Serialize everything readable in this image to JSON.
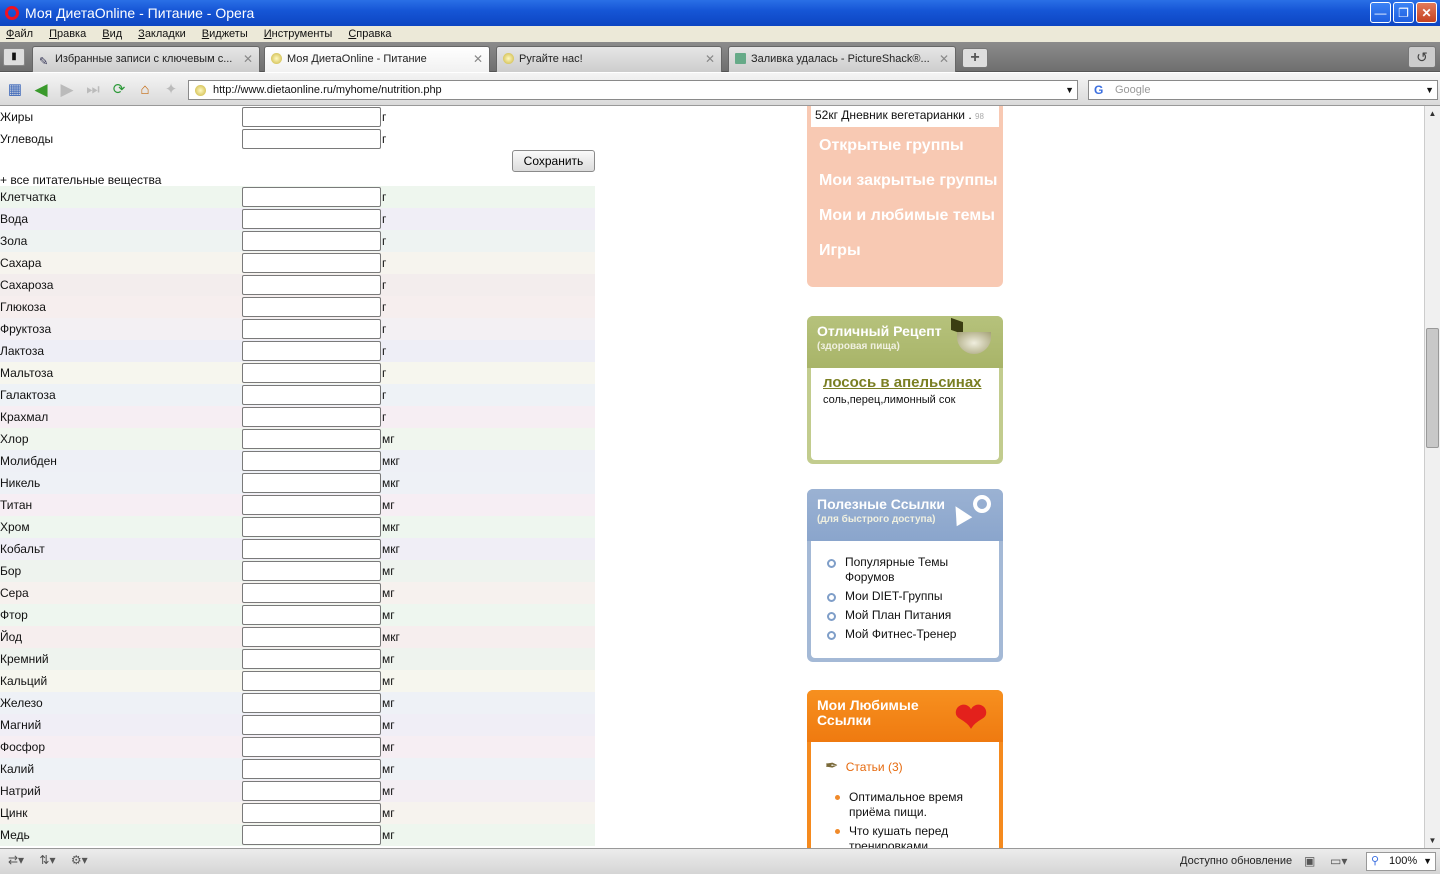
{
  "window": {
    "title": "Моя ДиетаOnline - Питание - Opera"
  },
  "menu": [
    "Файл",
    "Правка",
    "Вид",
    "Закладки",
    "Виджеты",
    "Инструменты",
    "Справка"
  ],
  "tabs": [
    {
      "label": "Избранные записи с ключевым с...",
      "active": false
    },
    {
      "label": "Моя ДиетаOnline - Питание",
      "active": true
    },
    {
      "label": "Ругайте нас!",
      "active": false
    },
    {
      "label": "Заливка удалась - PictureShack®...",
      "active": false
    }
  ],
  "address": {
    "url": "http://www.dietaonline.ru/myhome/nutrition.php",
    "search_placeholder": "Google"
  },
  "form": {
    "top_rows": [
      {
        "label": "Жиры",
        "unit": "г"
      },
      {
        "label": "Углеводы",
        "unit": "г"
      }
    ],
    "save_label": "Сохранить",
    "all_nutrients_label": "+ все питательные вещества",
    "nutrients": [
      {
        "label": "Клетчатка",
        "unit": "г",
        "bg": "#eef6ee"
      },
      {
        "label": "Вода",
        "unit": "г",
        "bg": "#f0eef6"
      },
      {
        "label": "Зола",
        "unit": "г",
        "bg": "#eef3f2"
      },
      {
        "label": "Сахара",
        "unit": "г",
        "bg": "#f6f4ee"
      },
      {
        "label": "Сахароза",
        "unit": "г",
        "bg": "#f3eded"
      },
      {
        "label": "Глюкоза",
        "unit": "г",
        "bg": "#f6eeee"
      },
      {
        "label": "Фруктоза",
        "unit": "г",
        "bg": "#f3f0f3"
      },
      {
        "label": "Лактоза",
        "unit": "г",
        "bg": "#eeeef6"
      },
      {
        "label": "Мальтоза",
        "unit": "г",
        "bg": "#f6f6ee"
      },
      {
        "label": "Галактоза",
        "unit": "г",
        "bg": "#eef2f6"
      },
      {
        "label": "Крахмал",
        "unit": "г",
        "bg": "#f6eef3"
      },
      {
        "label": "Хлор",
        "unit": "мг",
        "bg": "#f0f6ee"
      },
      {
        "label": "Молибден",
        "unit": "мкг",
        "bg": "#eef0f6"
      },
      {
        "label": "Никель",
        "unit": "мкг",
        "bg": "#eef1f6"
      },
      {
        "label": "Титан",
        "unit": "мг",
        "bg": "#f6eef4"
      },
      {
        "label": "Хром",
        "unit": "мкг",
        "bg": "#eef6ef"
      },
      {
        "label": "Кобальт",
        "unit": "мкг",
        "bg": "#f0eef6"
      },
      {
        "label": "Бор",
        "unit": "мг",
        "bg": "#eef3ee"
      },
      {
        "label": "Сера",
        "unit": "мг",
        "bg": "#f6f1ee"
      },
      {
        "label": "Фтор",
        "unit": "мг",
        "bg": "#eef6ef"
      },
      {
        "label": "Йод",
        "unit": "мкг",
        "bg": "#f6eeee"
      },
      {
        "label": "Кремний",
        "unit": "мг",
        "bg": "#eef3ee"
      },
      {
        "label": "Кальций",
        "unit": "мг",
        "bg": "#f6f6ee"
      },
      {
        "label": "Железо",
        "unit": "мг",
        "bg": "#eef1f6"
      },
      {
        "label": "Магний",
        "unit": "мг",
        "bg": "#f0eef6"
      },
      {
        "label": "Фосфор",
        "unit": "мг",
        "bg": "#f6eef3"
      },
      {
        "label": "Калий",
        "unit": "мг",
        "bg": "#eef2f6"
      },
      {
        "label": "Натрий",
        "unit": "мг",
        "bg": "#f3eef3"
      },
      {
        "label": "Цинк",
        "unit": "мг",
        "bg": "#f6f3ee"
      },
      {
        "label": "Медь",
        "unit": "мг",
        "bg": "#eef6ee"
      }
    ]
  },
  "sidebar": {
    "diary_text": "52кг Дневник вегетарианки .",
    "diary_count": "98",
    "group_links": [
      "Открытые группы",
      "Мои закрытые группы",
      "Мои и любимые темы",
      "Игры"
    ],
    "recipe": {
      "title": "Отличный Рецепт",
      "subtitle": "(здоровая пища)",
      "name": "лосось в апельсинах",
      "desc": "соль,перец,лимонный сок"
    },
    "useful_links": {
      "title": "Полезные Ссылки",
      "subtitle": "(для быстрого доступа)",
      "items": [
        "Популярные Темы Форумов",
        "Мои DIET-Группы",
        "Мой План Питания",
        "Мой Фитнес-Тренер"
      ]
    },
    "favorites": {
      "title": "Мои Любимые Ссылки",
      "articles": "Статьи (3)",
      "items": [
        "Оптимальное время приёма пищи.",
        "Что кушать перед тренировками."
      ]
    }
  },
  "status": {
    "update_text": "Доступно обновление",
    "zoom": "100%"
  }
}
